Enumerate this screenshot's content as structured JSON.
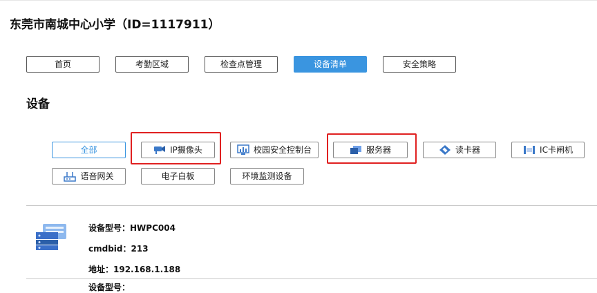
{
  "page": {
    "title": "东莞市南城中心小学（ID=1117911）"
  },
  "tabs": [
    {
      "label": "首页",
      "active": false
    },
    {
      "label": "考勤区域",
      "active": false
    },
    {
      "label": "检查点管理",
      "active": false
    },
    {
      "label": "设备清单",
      "active": true
    },
    {
      "label": "安全策略",
      "active": false
    }
  ],
  "section": {
    "title": "设备"
  },
  "device_types": [
    {
      "label": "全部",
      "icon": "none",
      "active": true,
      "highlighted": false
    },
    {
      "label": "IP摄像头",
      "icon": "ip-camera-icon",
      "active": false,
      "highlighted": true
    },
    {
      "label": "校园安全控制台",
      "icon": "control-console-icon",
      "active": false,
      "highlighted": false
    },
    {
      "label": "服务器",
      "icon": "server-icon",
      "active": false,
      "highlighted": true
    },
    {
      "label": "读卡器",
      "icon": "card-reader-icon",
      "active": false,
      "highlighted": false
    },
    {
      "label": "IC卡闸机",
      "icon": "ic-gate-icon",
      "active": false,
      "highlighted": false
    },
    {
      "label": "语音网关",
      "icon": "voice-gateway-icon",
      "active": false,
      "highlighted": false
    },
    {
      "label": "电子白板",
      "icon": "none",
      "active": false,
      "highlighted": false
    },
    {
      "label": "环境监测设备",
      "icon": "none",
      "active": false,
      "highlighted": false
    }
  ],
  "device": {
    "model_line": "设备型号：HWPC004",
    "cmdbid_line": "cmdbid：213",
    "address_line": "地址：192.168.1.188",
    "image_icon": "server-device-icon"
  },
  "next_device": {
    "partial_line": "设备型号："
  },
  "colors": {
    "accent": "#3a95e0",
    "highlight": "#e02020"
  }
}
